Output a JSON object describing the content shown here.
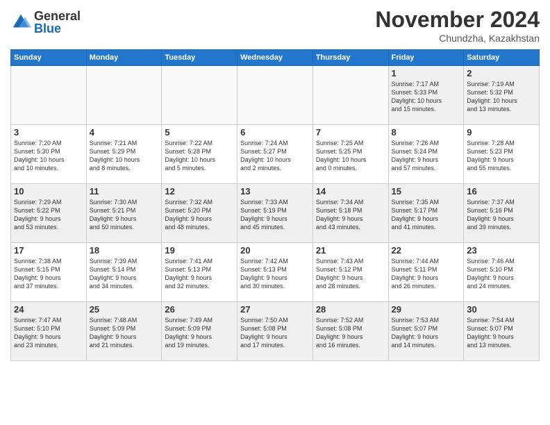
{
  "logo": {
    "general": "General",
    "blue": "Blue"
  },
  "header": {
    "month": "November 2024",
    "location": "Chundzha, Kazakhstan"
  },
  "weekdays": [
    "Sunday",
    "Monday",
    "Tuesday",
    "Wednesday",
    "Thursday",
    "Friday",
    "Saturday"
  ],
  "weeks": [
    [
      {
        "day": "",
        "info": ""
      },
      {
        "day": "",
        "info": ""
      },
      {
        "day": "",
        "info": ""
      },
      {
        "day": "",
        "info": ""
      },
      {
        "day": "",
        "info": ""
      },
      {
        "day": "1",
        "info": "Sunrise: 7:17 AM\nSunset: 5:33 PM\nDaylight: 10 hours\nand 15 minutes."
      },
      {
        "day": "2",
        "info": "Sunrise: 7:19 AM\nSunset: 5:32 PM\nDaylight: 10 hours\nand 13 minutes."
      }
    ],
    [
      {
        "day": "3",
        "info": "Sunrise: 7:20 AM\nSunset: 5:30 PM\nDaylight: 10 hours\nand 10 minutes."
      },
      {
        "day": "4",
        "info": "Sunrise: 7:21 AM\nSunset: 5:29 PM\nDaylight: 10 hours\nand 8 minutes."
      },
      {
        "day": "5",
        "info": "Sunrise: 7:22 AM\nSunset: 5:28 PM\nDaylight: 10 hours\nand 5 minutes."
      },
      {
        "day": "6",
        "info": "Sunrise: 7:24 AM\nSunset: 5:27 PM\nDaylight: 10 hours\nand 2 minutes."
      },
      {
        "day": "7",
        "info": "Sunrise: 7:25 AM\nSunset: 5:25 PM\nDaylight: 10 hours\nand 0 minutes."
      },
      {
        "day": "8",
        "info": "Sunrise: 7:26 AM\nSunset: 5:24 PM\nDaylight: 9 hours\nand 57 minutes."
      },
      {
        "day": "9",
        "info": "Sunrise: 7:28 AM\nSunset: 5:23 PM\nDaylight: 9 hours\nand 55 minutes."
      }
    ],
    [
      {
        "day": "10",
        "info": "Sunrise: 7:29 AM\nSunset: 5:22 PM\nDaylight: 9 hours\nand 53 minutes."
      },
      {
        "day": "11",
        "info": "Sunrise: 7:30 AM\nSunset: 5:21 PM\nDaylight: 9 hours\nand 50 minutes."
      },
      {
        "day": "12",
        "info": "Sunrise: 7:32 AM\nSunset: 5:20 PM\nDaylight: 9 hours\nand 48 minutes."
      },
      {
        "day": "13",
        "info": "Sunrise: 7:33 AM\nSunset: 5:19 PM\nDaylight: 9 hours\nand 45 minutes."
      },
      {
        "day": "14",
        "info": "Sunrise: 7:34 AM\nSunset: 5:18 PM\nDaylight: 9 hours\nand 43 minutes."
      },
      {
        "day": "15",
        "info": "Sunrise: 7:35 AM\nSunset: 5:17 PM\nDaylight: 9 hours\nand 41 minutes."
      },
      {
        "day": "16",
        "info": "Sunrise: 7:37 AM\nSunset: 5:16 PM\nDaylight: 9 hours\nand 39 minutes."
      }
    ],
    [
      {
        "day": "17",
        "info": "Sunrise: 7:38 AM\nSunset: 5:15 PM\nDaylight: 9 hours\nand 37 minutes."
      },
      {
        "day": "18",
        "info": "Sunrise: 7:39 AM\nSunset: 5:14 PM\nDaylight: 9 hours\nand 34 minutes."
      },
      {
        "day": "19",
        "info": "Sunrise: 7:41 AM\nSunset: 5:13 PM\nDaylight: 9 hours\nand 32 minutes."
      },
      {
        "day": "20",
        "info": "Sunrise: 7:42 AM\nSunset: 5:13 PM\nDaylight: 9 hours\nand 30 minutes."
      },
      {
        "day": "21",
        "info": "Sunrise: 7:43 AM\nSunset: 5:12 PM\nDaylight: 9 hours\nand 28 minutes."
      },
      {
        "day": "22",
        "info": "Sunrise: 7:44 AM\nSunset: 5:11 PM\nDaylight: 9 hours\nand 26 minutes."
      },
      {
        "day": "23",
        "info": "Sunrise: 7:46 AM\nSunset: 5:10 PM\nDaylight: 9 hours\nand 24 minutes."
      }
    ],
    [
      {
        "day": "24",
        "info": "Sunrise: 7:47 AM\nSunset: 5:10 PM\nDaylight: 9 hours\nand 23 minutes."
      },
      {
        "day": "25",
        "info": "Sunrise: 7:48 AM\nSunset: 5:09 PM\nDaylight: 9 hours\nand 21 minutes."
      },
      {
        "day": "26",
        "info": "Sunrise: 7:49 AM\nSunset: 5:09 PM\nDaylight: 9 hours\nand 19 minutes."
      },
      {
        "day": "27",
        "info": "Sunrise: 7:50 AM\nSunset: 5:08 PM\nDaylight: 9 hours\nand 17 minutes."
      },
      {
        "day": "28",
        "info": "Sunrise: 7:52 AM\nSunset: 5:08 PM\nDaylight: 9 hours\nand 16 minutes."
      },
      {
        "day": "29",
        "info": "Sunrise: 7:53 AM\nSunset: 5:07 PM\nDaylight: 9 hours\nand 14 minutes."
      },
      {
        "day": "30",
        "info": "Sunrise: 7:54 AM\nSunset: 5:07 PM\nDaylight: 9 hours\nand 13 minutes."
      }
    ]
  ]
}
